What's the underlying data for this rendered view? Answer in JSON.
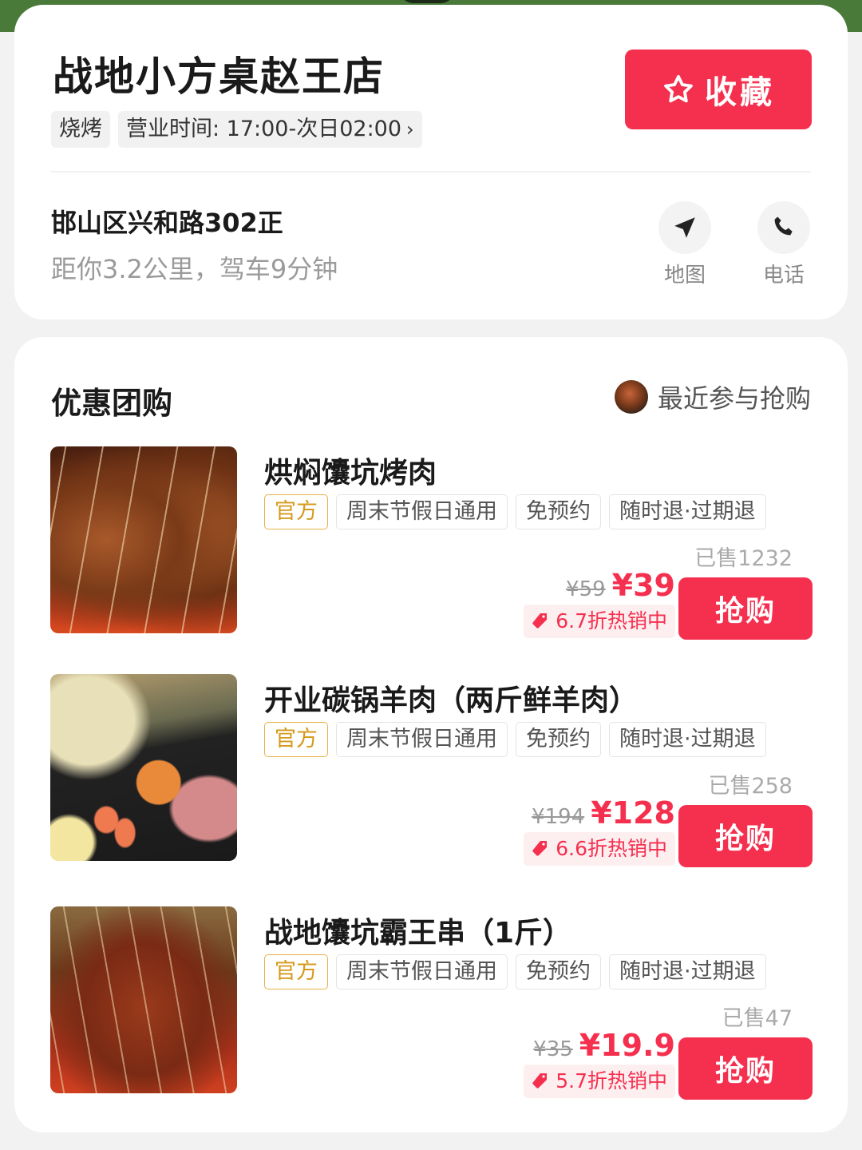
{
  "shop": {
    "name": "战地小方桌赵王店",
    "category": "烧烤",
    "hours": "营业时间: 17:00-次日02:00",
    "favorite_label": "收藏",
    "address": "邯山区兴和路302正",
    "distance": "距你3.2公里，驾车9分钟",
    "map_label": "地图",
    "phone_label": "电话"
  },
  "deals_section": {
    "title": "优惠团购",
    "recent_label": "最近参与抢购",
    "buy_label": "抢购",
    "items": [
      {
        "name": "烘焖馕坑烤肉",
        "tags": [
          "官方",
          "周末节假日通用",
          "免预约",
          "随时退·过期退"
        ],
        "sold": "已售1232",
        "original_price": "¥59",
        "price": "¥39",
        "discount": "6.7折热销中"
      },
      {
        "name": "开业碳锅羊肉（两斤鲜羊肉）",
        "tags": [
          "官方",
          "周末节假日通用",
          "免预约",
          "随时退·过期退"
        ],
        "sold": "已售258",
        "original_price": "¥194",
        "price": "¥128",
        "discount": "6.6折热销中"
      },
      {
        "name": "战地馕坑霸王串（1斤）",
        "tags": [
          "官方",
          "周末节假日通用",
          "免预约",
          "随时退·过期退"
        ],
        "sold": "已售47",
        "original_price": "¥35",
        "price": "¥19.9",
        "discount": "5.7折热销中"
      }
    ]
  },
  "colors": {
    "accent": "#f5304f",
    "official_tag": "#d59a1c",
    "muted_text": "#9a9a9a"
  }
}
